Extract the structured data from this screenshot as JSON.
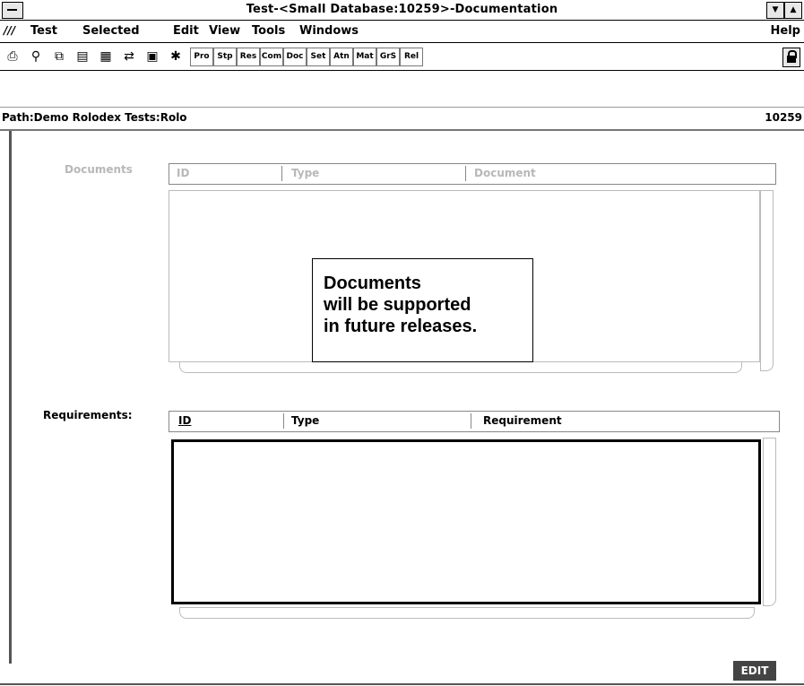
{
  "window": {
    "title": "Test-<Small Database:10259>-Documentation"
  },
  "menu": {
    "logo": "///",
    "items": [
      {
        "label": "Test",
        "mnemonic_index": -1
      },
      {
        "label": "Selected"
      },
      {
        "label": "Edit"
      },
      {
        "label": "View"
      },
      {
        "label": "Tools"
      },
      {
        "label": "Windows"
      }
    ],
    "help": "Help"
  },
  "toolbar": {
    "icons": [
      "print-icon",
      "wrench-icon",
      "copy-icon",
      "paste-icon",
      "tree-icon",
      "link-icon",
      "save-icon",
      "run-icon"
    ],
    "buttons": [
      "Pro",
      "Stp",
      "Res",
      "Com",
      "Doc",
      "Set",
      "Atn",
      "Mat",
      "GrS",
      "Rel"
    ]
  },
  "path": {
    "text": "Path:Demo Rolodex Tests:Rolo",
    "id": "10259"
  },
  "documents": {
    "label": "Documents",
    "columns": [
      "ID",
      "Type",
      "Document"
    ]
  },
  "message": {
    "lines": [
      "Documents",
      "will be supported",
      "in future releases."
    ]
  },
  "requirements": {
    "label": "Requirements:",
    "columns": [
      "ID",
      "Type",
      "Requirement"
    ]
  },
  "status": {
    "edit_label": "EDIT"
  }
}
